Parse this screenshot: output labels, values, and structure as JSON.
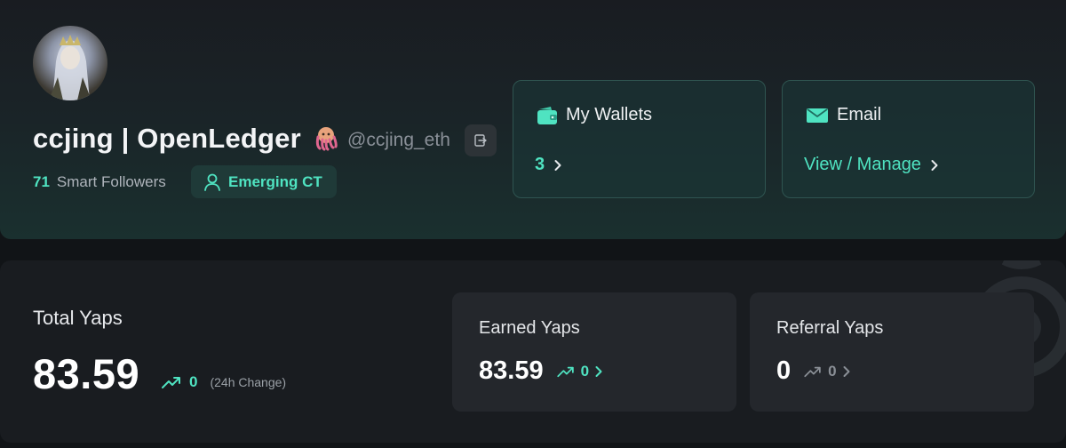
{
  "profile": {
    "display_name": "ccjing | OpenLedger",
    "handle": "@ccjing_eth",
    "smart_followers_count": "71",
    "smart_followers_label": "Smart Followers",
    "tier_label": "Emerging CT",
    "badge_icon": "octopus-badge-icon"
  },
  "wallets": {
    "title": "My Wallets",
    "value": "3"
  },
  "email": {
    "title": "Email",
    "link": "View / Manage"
  },
  "yaps": {
    "total_title": "Total Yaps",
    "total_value": "83.59",
    "total_change": "0",
    "change_note": "(24h Change)",
    "earned_title": "Earned Yaps",
    "earned_value": "83.59",
    "earned_change": "0",
    "referral_title": "Referral Yaps",
    "referral_value": "0",
    "referral_change": "0"
  },
  "colors": {
    "accent": "#4fe3c1",
    "background": "#111417",
    "card": "#191c20"
  }
}
